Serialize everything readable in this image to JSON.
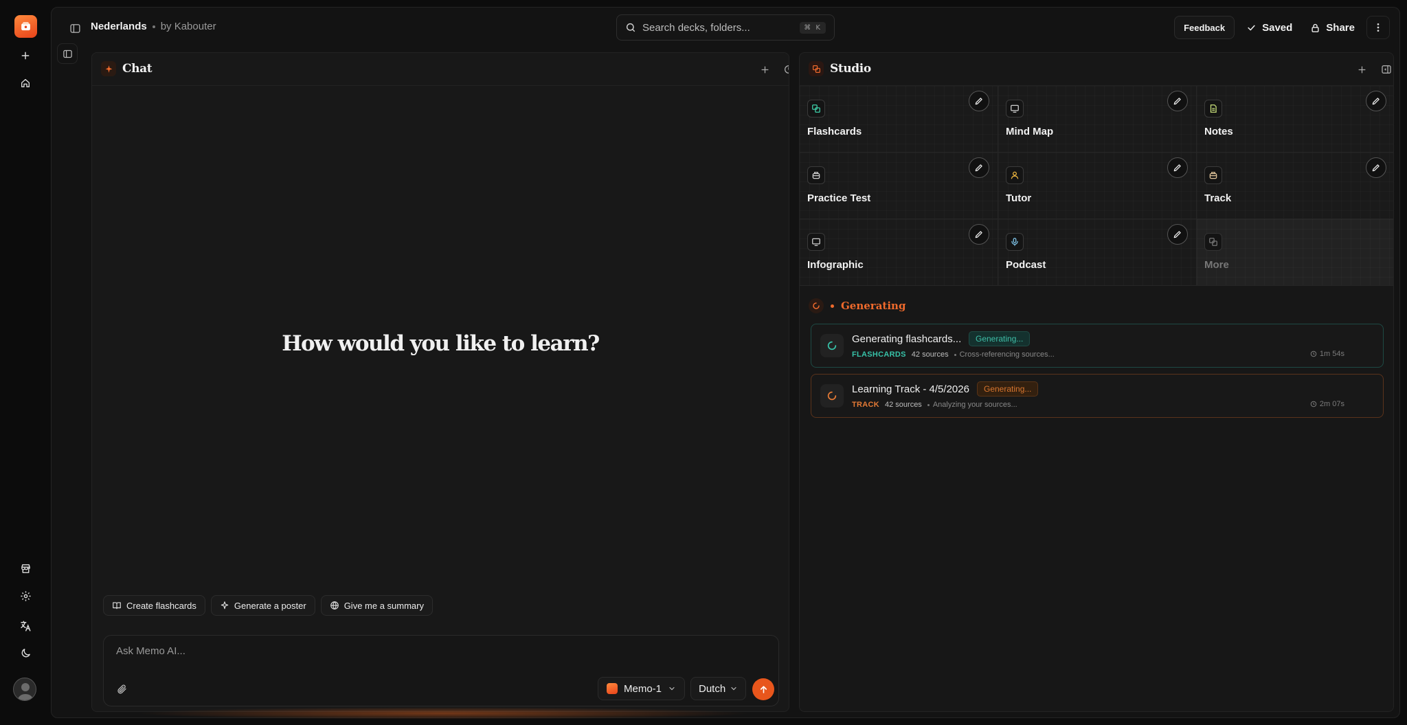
{
  "app": {
    "document_title": "Nederlands",
    "author": "by Kabouter"
  },
  "search": {
    "placeholder": "Search decks, folders...",
    "shortcut": "⌘ K"
  },
  "header": {
    "feedback_label": "Feedback",
    "saved_label": "Saved",
    "share_label": "Share"
  },
  "rail": {
    "icons": [
      "app-logo",
      "plus-icon",
      "home-icon",
      "store-icon",
      "gear-icon",
      "translate-icon",
      "moon-icon",
      "avatar"
    ]
  },
  "chat": {
    "title": "Chat",
    "hero": "How would you like to learn?",
    "suggestions": [
      {
        "label": "Create flashcards",
        "icon": "book-icon"
      },
      {
        "label": "Generate a poster",
        "icon": "sparkle-icon"
      },
      {
        "label": "Give me a summary",
        "icon": "globe-icon"
      }
    ],
    "input_placeholder": "Ask Memo AI...",
    "model": "Memo-1",
    "language": "Dutch"
  },
  "studio": {
    "title": "Studio",
    "tools": [
      {
        "label": "Flashcards",
        "icon": "cards-icon",
        "color": "#3ecfa8"
      },
      {
        "label": "Mind Map",
        "icon": "monitor-icon",
        "color": "#d0d0d0"
      },
      {
        "label": "Notes",
        "icon": "notes-icon",
        "color": "#c8e07a"
      },
      {
        "label": "Practice Test",
        "icon": "test-icon",
        "color": "#d0d0d0"
      },
      {
        "label": "Tutor",
        "icon": "person-icon",
        "color": "#f0b840"
      },
      {
        "label": "Track",
        "icon": "track-icon",
        "color": "#e0c49a"
      },
      {
        "label": "Infographic",
        "icon": "monitor-icon",
        "color": "#d0d0d0"
      },
      {
        "label": "Podcast",
        "icon": "mic-icon",
        "color": "#7fc4e8"
      },
      {
        "label": "More",
        "icon": "cards-icon",
        "color": "#777777"
      }
    ],
    "generating_label": "Generating",
    "jobs": [
      {
        "title": "Generating flashcards...",
        "status": "Generating...",
        "type": "FLASHCARDS",
        "sources": "42 sources",
        "note": "Cross-referencing sources...",
        "elapsed": "1m 54s"
      },
      {
        "title": "Learning Track - 4/5/2026",
        "status": "Generating...",
        "type": "TRACK",
        "sources": "42 sources",
        "note": "Analyzing your sources...",
        "elapsed": "2m 07s"
      }
    ]
  },
  "colors": {
    "accent": "#e8561c",
    "teal": "#37c2a8",
    "background": "#131313"
  }
}
